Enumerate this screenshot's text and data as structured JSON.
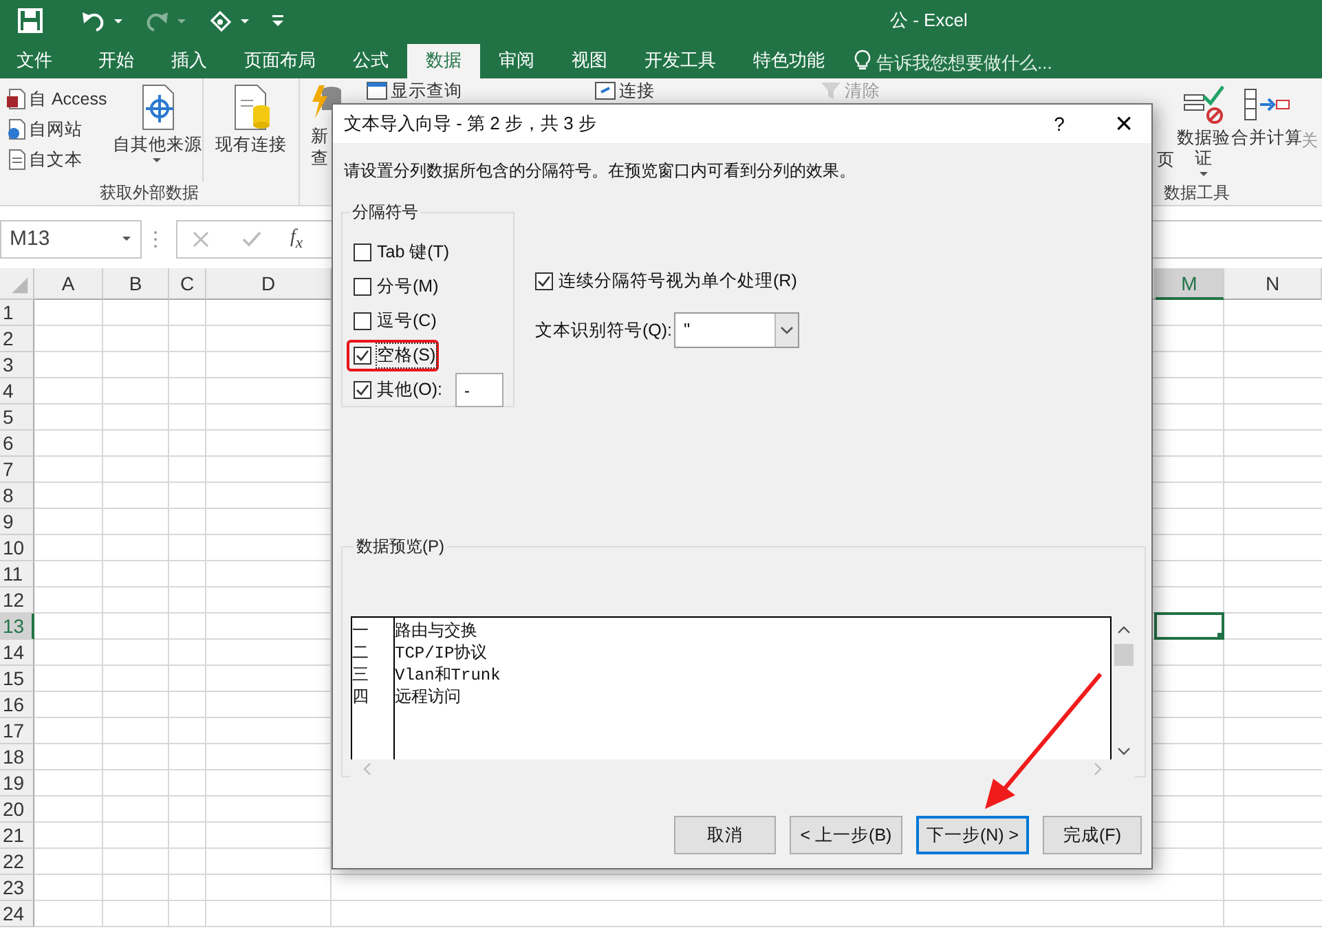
{
  "window": {
    "title": "公 - Excel"
  },
  "quick_access": [
    {
      "kind": "save",
      "disabled": false
    },
    {
      "kind": "undo",
      "disabled": false
    },
    {
      "kind": "redo",
      "disabled": true
    },
    {
      "kind": "touch",
      "disabled": false
    },
    {
      "kind": "customize",
      "disabled": false
    }
  ],
  "ribbon_tabs": [
    {
      "label": "文件",
      "selected": false
    },
    {
      "label": "开始",
      "selected": false
    },
    {
      "label": "插入",
      "selected": false
    },
    {
      "label": "页面布局",
      "selected": false
    },
    {
      "label": "公式",
      "selected": false
    },
    {
      "label": "数据",
      "selected": true
    },
    {
      "label": "审阅",
      "selected": false
    },
    {
      "label": "视图",
      "selected": false
    },
    {
      "label": "开发工具",
      "selected": false
    },
    {
      "label": "特色功能",
      "selected": false
    }
  ],
  "tell_me": {
    "placeholder": "告诉我您想要做什么..."
  },
  "ribbon": {
    "small_buttons": [
      {
        "label": "自 Access",
        "kind": "access"
      },
      {
        "label": "自网站",
        "kind": "web"
      },
      {
        "label": "自文本",
        "kind": "text"
      }
    ],
    "large_buttons": [
      {
        "label": "自其他来源",
        "kind": "other"
      },
      {
        "label": "现有连接",
        "kind": "existing"
      }
    ],
    "group_label": "获取外部数据",
    "cut_button": [
      "新",
      "查"
    ],
    "top_strip": [
      {
        "label": "显示查询",
        "disabled": false
      },
      {
        "label": "连接",
        "disabled": false
      },
      {
        "label": "清除",
        "disabled": true
      }
    ],
    "cut_right": "页",
    "data_validation": [
      "数据验",
      "证"
    ],
    "consolidate": "合并计算",
    "cut_far": "关",
    "tools_label": "数据工具"
  },
  "name_box": {
    "value": "M13"
  },
  "formula_bar": {
    "function_label": "f$_{x}$"
  },
  "sheet": {
    "columns": [
      {
        "label": "A",
        "selected": false
      },
      {
        "label": "B",
        "selected": false
      },
      {
        "label": "C",
        "selected": false
      },
      {
        "label": "D",
        "selected": false
      },
      {
        "label": "M",
        "selected": true
      },
      {
        "label": "N",
        "selected": false
      }
    ],
    "rows": [
      {
        "label": "1",
        "selected": false
      },
      {
        "label": "2",
        "selected": false
      },
      {
        "label": "3",
        "selected": false
      },
      {
        "label": "4",
        "selected": false
      },
      {
        "label": "5",
        "selected": false
      },
      {
        "label": "6",
        "selected": false
      },
      {
        "label": "7",
        "selected": false
      },
      {
        "label": "8",
        "selected": false
      },
      {
        "label": "9",
        "selected": false
      },
      {
        "label": "10",
        "selected": false
      },
      {
        "label": "11",
        "selected": false
      },
      {
        "label": "12",
        "selected": false
      },
      {
        "label": "13",
        "selected": true
      },
      {
        "label": "14",
        "selected": false
      },
      {
        "label": "15",
        "selected": false
      },
      {
        "label": "16",
        "selected": false
      },
      {
        "label": "17",
        "selected": false
      },
      {
        "label": "18",
        "selected": false
      },
      {
        "label": "19",
        "selected": false
      },
      {
        "label": "20",
        "selected": false
      },
      {
        "label": "21",
        "selected": false
      },
      {
        "label": "22",
        "selected": false
      },
      {
        "label": "23",
        "selected": false
      },
      {
        "label": "24",
        "selected": false
      }
    ]
  },
  "dialog": {
    "title": "文本导入向导 - 第 2 步，共 3 步",
    "help": "?",
    "close": "×",
    "instruction": "请设置分列数据所包含的分隔符号。在预览窗口内可看到分列的效果。",
    "delimiters": {
      "label": "分隔符号",
      "options": [
        {
          "label": "Tab 键(T)",
          "checked": false,
          "highlighted": false
        },
        {
          "label": "分号(M)",
          "checked": false,
          "highlighted": false
        },
        {
          "label": "逗号(C)",
          "checked": false,
          "highlighted": false
        },
        {
          "label": "空格(S)",
          "checked": true,
          "highlighted": true
        },
        {
          "label": "其他(O):",
          "checked": true,
          "highlighted": false
        }
      ],
      "other_value": "-"
    },
    "consecutive": {
      "label": "连续分隔符号视为单个处理(R)",
      "checked": true
    },
    "qualifier": {
      "label": "文本识别符号(Q):",
      "value": "\""
    },
    "preview": {
      "label": "数据预览(P)",
      "rows": [
        [
          "一",
          "路由与交换"
        ],
        [
          "二",
          "TCP/IP协议"
        ],
        [
          "三",
          "Vlan和Trunk"
        ],
        [
          "四",
          "远程访问"
        ]
      ]
    },
    "buttons": [
      {
        "label": "取消",
        "focused": false
      },
      {
        "label": "< 上一步(B)",
        "focused": false
      },
      {
        "label": "下一步(N) >",
        "focused": true
      },
      {
        "label": "完成(F)",
        "focused": false
      }
    ]
  }
}
